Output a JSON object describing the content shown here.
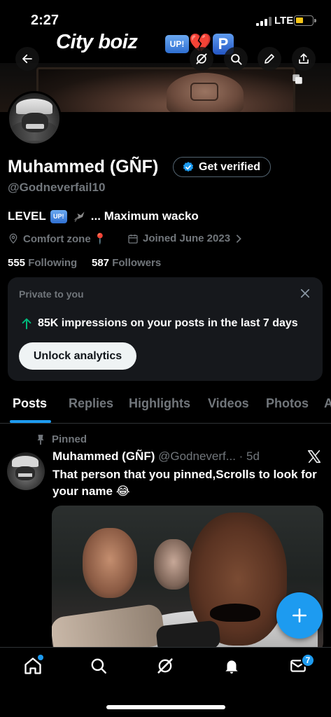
{
  "status_bar": {
    "time": "2:27",
    "network": "LTE"
  },
  "profile_header": {
    "title": "City boiz",
    "emojis": {
      "up": "UP!",
      "heart": "💔",
      "parking": "P"
    }
  },
  "profile": {
    "display_name": "Muhammed (GÑF)",
    "verify_label": "Get verified",
    "handle": "@Godneverfail10",
    "bio": {
      "prefix": "LEVEL",
      "up": "UP!",
      "suffix": "... Maximum wacko"
    },
    "location": "Comfort zone 📍",
    "joined": "Joined June 2023",
    "following_count": "555",
    "following_label": "Following",
    "followers_count": "587",
    "followers_label": "Followers"
  },
  "analytics_card": {
    "label": "Private to you",
    "impressions_text": "85K impressions on your posts in the last 7 days",
    "button_label": "Unlock analytics"
  },
  "tabs": [
    {
      "label": "Posts",
      "active": true
    },
    {
      "label": "Replies"
    },
    {
      "label": "Highlights"
    },
    {
      "label": "Videos"
    },
    {
      "label": "Photos"
    },
    {
      "label": "A"
    }
  ],
  "post": {
    "pinned_label": "Pinned",
    "author": "Muhammed (GÑF)",
    "handle_time": "@Godneverf... · 5d",
    "text": "That person that you pinned,Scrolls to look for your name 😂"
  },
  "bottom_nav": {
    "messages_badge": "7"
  },
  "colors": {
    "accent": "#1d9bf0",
    "background": "#000000",
    "muted": "#71767b",
    "card": "#16181c",
    "impressions_arrow": "#00ba7c"
  },
  "icons": [
    "back-arrow-icon",
    "grok-icon",
    "search-icon",
    "edit-pencil-icon",
    "share-icon",
    "copy-icon",
    "verified-badge-icon",
    "location-pin-icon",
    "calendar-icon",
    "chevron-right-icon",
    "close-icon",
    "arrow-up-icon",
    "pin-icon",
    "x-logo-icon",
    "plus-icon",
    "home-icon",
    "bell-icon",
    "mail-icon"
  ]
}
